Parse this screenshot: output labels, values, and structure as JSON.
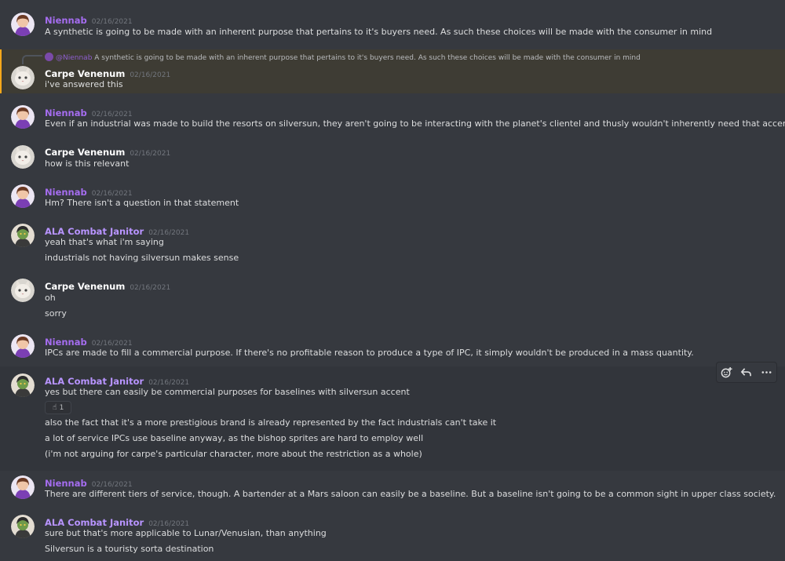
{
  "users": {
    "niennab": "Niennab",
    "carpe": "Carpe Venenum",
    "ala": "ALA Combat Janitor"
  },
  "colors": {
    "background": "#36393f",
    "niennab": "#a56df0",
    "carpe": "#ffffff",
    "ala": "#b894ff",
    "reply_highlight_bar": "#faa81a"
  },
  "messages": [
    {
      "author": "Niennab",
      "timestamp": "02/16/2021",
      "lines": [
        "A synthetic is going to be made with an inherent purpose that pertains to it's buyers need. As such these choices will be made with the consumer in mind"
      ]
    },
    {
      "author": "Carpe Venenum",
      "timestamp": "02/16/2021",
      "reply_to": {
        "author": "@Niennab",
        "text": "A synthetic is going to be made with an inherent purpose that pertains to it's buyers need. As such these choices will be made with the consumer in mind"
      },
      "lines": [
        "i've answered this"
      ]
    },
    {
      "author": "Niennab",
      "timestamp": "02/16/2021",
      "lines": [
        "Even if an industrial was made to build the resorts on silversun, they aren't going to be interacting with the planet's clientel and thusly wouldn't inherently need that accent"
      ]
    },
    {
      "author": "Carpe Venenum",
      "timestamp": "02/16/2021",
      "lines": [
        "how is this relevant"
      ]
    },
    {
      "author": "Niennab",
      "timestamp": "02/16/2021",
      "lines": [
        "Hm? There isn't a question in that statement"
      ]
    },
    {
      "author": "ALA Combat Janitor",
      "timestamp": "02/16/2021",
      "lines": [
        "yeah that's what i'm saying",
        "industrials not having silversun makes sense"
      ]
    },
    {
      "author": "Carpe Venenum",
      "timestamp": "02/16/2021",
      "lines": [
        "oh",
        "sorry"
      ]
    },
    {
      "author": "Niennab",
      "timestamp": "02/16/2021",
      "lines": [
        "IPCs are made to fill a commercial purpose. If there's no profitable reason to produce a type of IPC, it simply wouldn't be produced in a mass quantity."
      ]
    },
    {
      "author": "ALA Combat Janitor",
      "timestamp": "02/16/2021",
      "lines": [
        "yes but there can easily be commercial purposes for baselines with silversun accent",
        "also the fact that it's a more prestigious brand is already represented by the fact industrials can't take it",
        "a lot of service IPCs use baseline anyway, as the bishop sprites are hard to employ well",
        "(i'm not arguing for carpe's particular character, more about the restriction as a whole)"
      ],
      "reaction": {
        "emoji": "☝",
        "count": "1"
      }
    },
    {
      "author": "Niennab",
      "timestamp": "02/16/2021",
      "lines": [
        "There are different tiers of service, though. A bartender at a Mars saloon can easily be a baseline. But a baseline isn't going to be a common sight in upper class society."
      ]
    },
    {
      "author": "ALA Combat Janitor",
      "timestamp": "02/16/2021",
      "lines": [
        "sure but that's more applicable to Lunar/Venusian, than anything",
        "Silversun is a touristy sorta destination"
      ]
    }
  ],
  "toolbar": {
    "icons": [
      "add-reaction-icon",
      "reply-icon",
      "more-icon"
    ]
  }
}
